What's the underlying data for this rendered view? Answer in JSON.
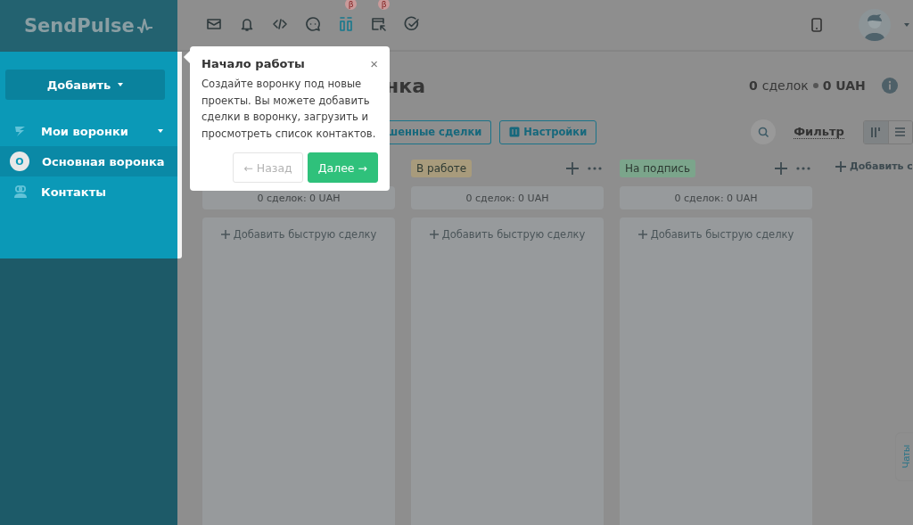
{
  "logo": "SendPulse",
  "toolbar": [
    {
      "kind": "mail"
    },
    {
      "kind": "bell"
    },
    {
      "kind": "code"
    },
    {
      "kind": "chat"
    },
    {
      "kind": "pipeline",
      "selected": true,
      "badge": "β"
    },
    {
      "kind": "window",
      "badge": "β"
    },
    {
      "kind": "check"
    }
  ],
  "sidebar": {
    "add_button": "Добавить",
    "items": [
      {
        "kind": "funnels",
        "label": "Мои воронки",
        "expanded": true,
        "selected": false
      },
      {
        "kind": "funnel",
        "label": "Основная воронка",
        "initial": "О",
        "selected": true
      },
      {
        "kind": "contacts",
        "label": "Контакты",
        "selected": false
      }
    ]
  },
  "tour": {
    "title": "Начало работы",
    "close": "×",
    "text": "Создайте воронку под новые проекты. Вы можете добавить сделки в воронку, загрузить и просмотреть список контактов.",
    "back": {
      "label": "← Назад",
      "disabled": true
    },
    "next": {
      "label": "Далее →",
      "disabled": false
    }
  },
  "page": {
    "title": "нка",
    "summary": {
      "count": "0",
      "count_label": "сделок",
      "amount": "0 UAH"
    },
    "buttons": [
      {
        "kind": "plain",
        "label": "шенные сделки"
      },
      {
        "kind": "settings",
        "label": "Настройки"
      }
    ],
    "filter": "Фильтр",
    "views": [
      {
        "kind": "board",
        "selected": true
      },
      {
        "kind": "list",
        "selected": false
      }
    ]
  },
  "columns": [
    {
      "count": "0 сделок: 0 UAH",
      "add": "Добавить быструю сделку"
    },
    {
      "tag": "В работе",
      "color": "#a89b7c",
      "count": "0 сделок: 0 UAH",
      "add": "Добавить быструю сделку"
    },
    {
      "tag": "На подпись",
      "color": "#7ba58b",
      "count": "0 сделок: 0 UAH",
      "add": "Добавить быструю сделку"
    }
  ],
  "add_column": "Добавить с",
  "chats": "Чаты"
}
